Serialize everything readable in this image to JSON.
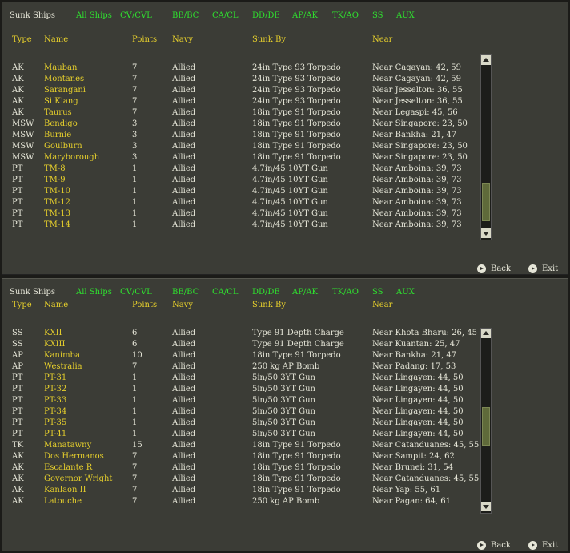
{
  "panels": [
    {
      "title": "Sunk Ships",
      "filters": [
        "All Ships",
        "CV/CVL",
        "BB/BC",
        "CA/CL",
        "DD/DE",
        "AP/AK",
        "TK/AO",
        "SS",
        "AUX"
      ],
      "headers": {
        "type": "Type",
        "name": "Name",
        "points": "Points",
        "navy": "Navy",
        "sunk_by": "Sunk By",
        "near": "Near"
      },
      "rows": [
        {
          "type": "AK",
          "name": "Mauban",
          "points": "7",
          "navy": "Allied",
          "sunk_by": "24in Type 93 Torpedo",
          "near": "Near Cagayan: 42, 59"
        },
        {
          "type": "AK",
          "name": "Montanes",
          "points": "7",
          "navy": "Allied",
          "sunk_by": "24in Type 93 Torpedo",
          "near": "Near Cagayan: 42, 59"
        },
        {
          "type": "AK",
          "name": "Sarangani",
          "points": "7",
          "navy": "Allied",
          "sunk_by": "24in Type 93 Torpedo",
          "near": "Near Jesselton: 36, 55"
        },
        {
          "type": "AK",
          "name": "Si Kiang",
          "points": "7",
          "navy": "Allied",
          "sunk_by": "24in Type 93 Torpedo",
          "near": "Near Jesselton: 36, 55"
        },
        {
          "type": "AK",
          "name": "Taurus",
          "points": "7",
          "navy": "Allied",
          "sunk_by": "18in Type 91 Torpedo",
          "near": "Near Legaspi: 45, 56"
        },
        {
          "type": "MSW",
          "name": "Bendigo",
          "points": "3",
          "navy": "Allied",
          "sunk_by": "18in Type 91 Torpedo",
          "near": "Near Singapore: 23, 50"
        },
        {
          "type": "MSW",
          "name": "Burnie",
          "points": "3",
          "navy": "Allied",
          "sunk_by": "18in Type 91 Torpedo",
          "near": "Near Bankha: 21, 47"
        },
        {
          "type": "MSW",
          "name": "Goulburn",
          "points": "3",
          "navy": "Allied",
          "sunk_by": "18in Type 91 Torpedo",
          "near": "Near Singapore: 23, 50"
        },
        {
          "type": "MSW",
          "name": "Maryborough",
          "points": "3",
          "navy": "Allied",
          "sunk_by": "18in Type 91 Torpedo",
          "near": "Near Singapore: 23, 50"
        },
        {
          "type": "PT",
          "name": "TM-8",
          "points": "1",
          "navy": "Allied",
          "sunk_by": "4.7in/45 10YT Gun",
          "near": "Near Amboina: 39, 73"
        },
        {
          "type": "PT",
          "name": "TM-9",
          "points": "1",
          "navy": "Allied",
          "sunk_by": "4.7in/45 10YT Gun",
          "near": "Near Amboina: 39, 73"
        },
        {
          "type": "PT",
          "name": "TM-10",
          "points": "1",
          "navy": "Allied",
          "sunk_by": "4.7in/45 10YT Gun",
          "near": "Near Amboina: 39, 73"
        },
        {
          "type": "PT",
          "name": "TM-12",
          "points": "1",
          "navy": "Allied",
          "sunk_by": "4.7in/45 10YT Gun",
          "near": "Near Amboina: 39, 73"
        },
        {
          "type": "PT",
          "name": "TM-13",
          "points": "1",
          "navy": "Allied",
          "sunk_by": "4.7in/45 10YT Gun",
          "near": "Near Amboina: 39, 73"
        },
        {
          "type": "PT",
          "name": "TM-14",
          "points": "1",
          "navy": "Allied",
          "sunk_by": "4.7in/45 10YT Gun",
          "near": "Near Amboina: 39, 73"
        }
      ],
      "back_label": "Back",
      "exit_label": "Exit",
      "scroll_position": 0.95
    },
    {
      "title": "Sunk Ships",
      "filters": [
        "All Ships",
        "CV/CVL",
        "BB/BC",
        "CA/CL",
        "DD/DE",
        "AP/AK",
        "TK/AO",
        "SS",
        "AUX"
      ],
      "headers": {
        "type": "Type",
        "name": "Name",
        "points": "Points",
        "navy": "Navy",
        "sunk_by": "Sunk By",
        "near": "Near"
      },
      "rows": [
        {
          "type": "SS",
          "name": "KXII",
          "points": "6",
          "navy": "Allied",
          "sunk_by": "Type 91 Depth Charge",
          "near": "Near Khota Bharu: 26, 45"
        },
        {
          "type": "SS",
          "name": "KXIII",
          "points": "6",
          "navy": "Allied",
          "sunk_by": "Type 91 Depth Charge",
          "near": "Near Kuantan: 25, 47"
        },
        {
          "type": "AP",
          "name": "Kanimba",
          "points": "10",
          "navy": "Allied",
          "sunk_by": "18in Type 91 Torpedo",
          "near": "Near Bankha: 21, 47"
        },
        {
          "type": "AP",
          "name": "Westralia",
          "points": "7",
          "navy": "Allied",
          "sunk_by": "250 kg AP Bomb",
          "near": "Near Padang: 17, 53"
        },
        {
          "type": "PT",
          "name": "PT-31",
          "points": "1",
          "navy": "Allied",
          "sunk_by": "5in/50 3YT Gun",
          "near": "Near Lingayen: 44, 50"
        },
        {
          "type": "PT",
          "name": "PT-32",
          "points": "1",
          "navy": "Allied",
          "sunk_by": "5in/50 3YT Gun",
          "near": "Near Lingayen: 44, 50"
        },
        {
          "type": "PT",
          "name": "PT-33",
          "points": "1",
          "navy": "Allied",
          "sunk_by": "5in/50 3YT Gun",
          "near": "Near Lingayen: 44, 50"
        },
        {
          "type": "PT",
          "name": "PT-34",
          "points": "1",
          "navy": "Allied",
          "sunk_by": "5in/50 3YT Gun",
          "near": "Near Lingayen: 44, 50"
        },
        {
          "type": "PT",
          "name": "PT-35",
          "points": "1",
          "navy": "Allied",
          "sunk_by": "5in/50 3YT Gun",
          "near": "Near Lingayen: 44, 50"
        },
        {
          "type": "PT",
          "name": "PT-41",
          "points": "1",
          "navy": "Allied",
          "sunk_by": "5in/50 3YT Gun",
          "near": "Near Lingayen: 44, 50"
        },
        {
          "type": "TK",
          "name": "Manatawny",
          "points": "15",
          "navy": "Allied",
          "sunk_by": "18in Type 91 Torpedo",
          "near": "Near Catanduanes: 45, 55"
        },
        {
          "type": "AK",
          "name": "Dos Hermanos",
          "points": "7",
          "navy": "Allied",
          "sunk_by": "18in Type 91 Torpedo",
          "near": "Near Sampit: 24, 62"
        },
        {
          "type": "AK",
          "name": "Escalante R",
          "points": "7",
          "navy": "Allied",
          "sunk_by": "18in Type 91 Torpedo",
          "near": "Near Brunei: 31, 54"
        },
        {
          "type": "AK",
          "name": "Governor Wright",
          "points": "7",
          "navy": "Allied",
          "sunk_by": "18in Type 91 Torpedo",
          "near": "Near Catanduanes: 45, 55"
        },
        {
          "type": "AK",
          "name": "Kanlaon II",
          "points": "7",
          "navy": "Allied",
          "sunk_by": "18in Type 91 Torpedo",
          "near": "Near Yap: 55, 61"
        },
        {
          "type": "AK",
          "name": "Latouche",
          "points": "7",
          "navy": "Allied",
          "sunk_by": "250 kg AP Bomb",
          "near": "Near Pagan: 64, 61"
        }
      ],
      "back_label": "Back",
      "exit_label": "Exit",
      "scroll_position": 0.55
    }
  ],
  "colors": {
    "filter": "#2fe02f",
    "header": "#e6cf2c",
    "name": "#e6cf2c",
    "text": "#e6e6d8"
  },
  "icons": {
    "scroll_up": "scroll-up-arrow-icon",
    "scroll_down": "scroll-down-arrow-icon",
    "nav": "circle-arrow-icon"
  }
}
